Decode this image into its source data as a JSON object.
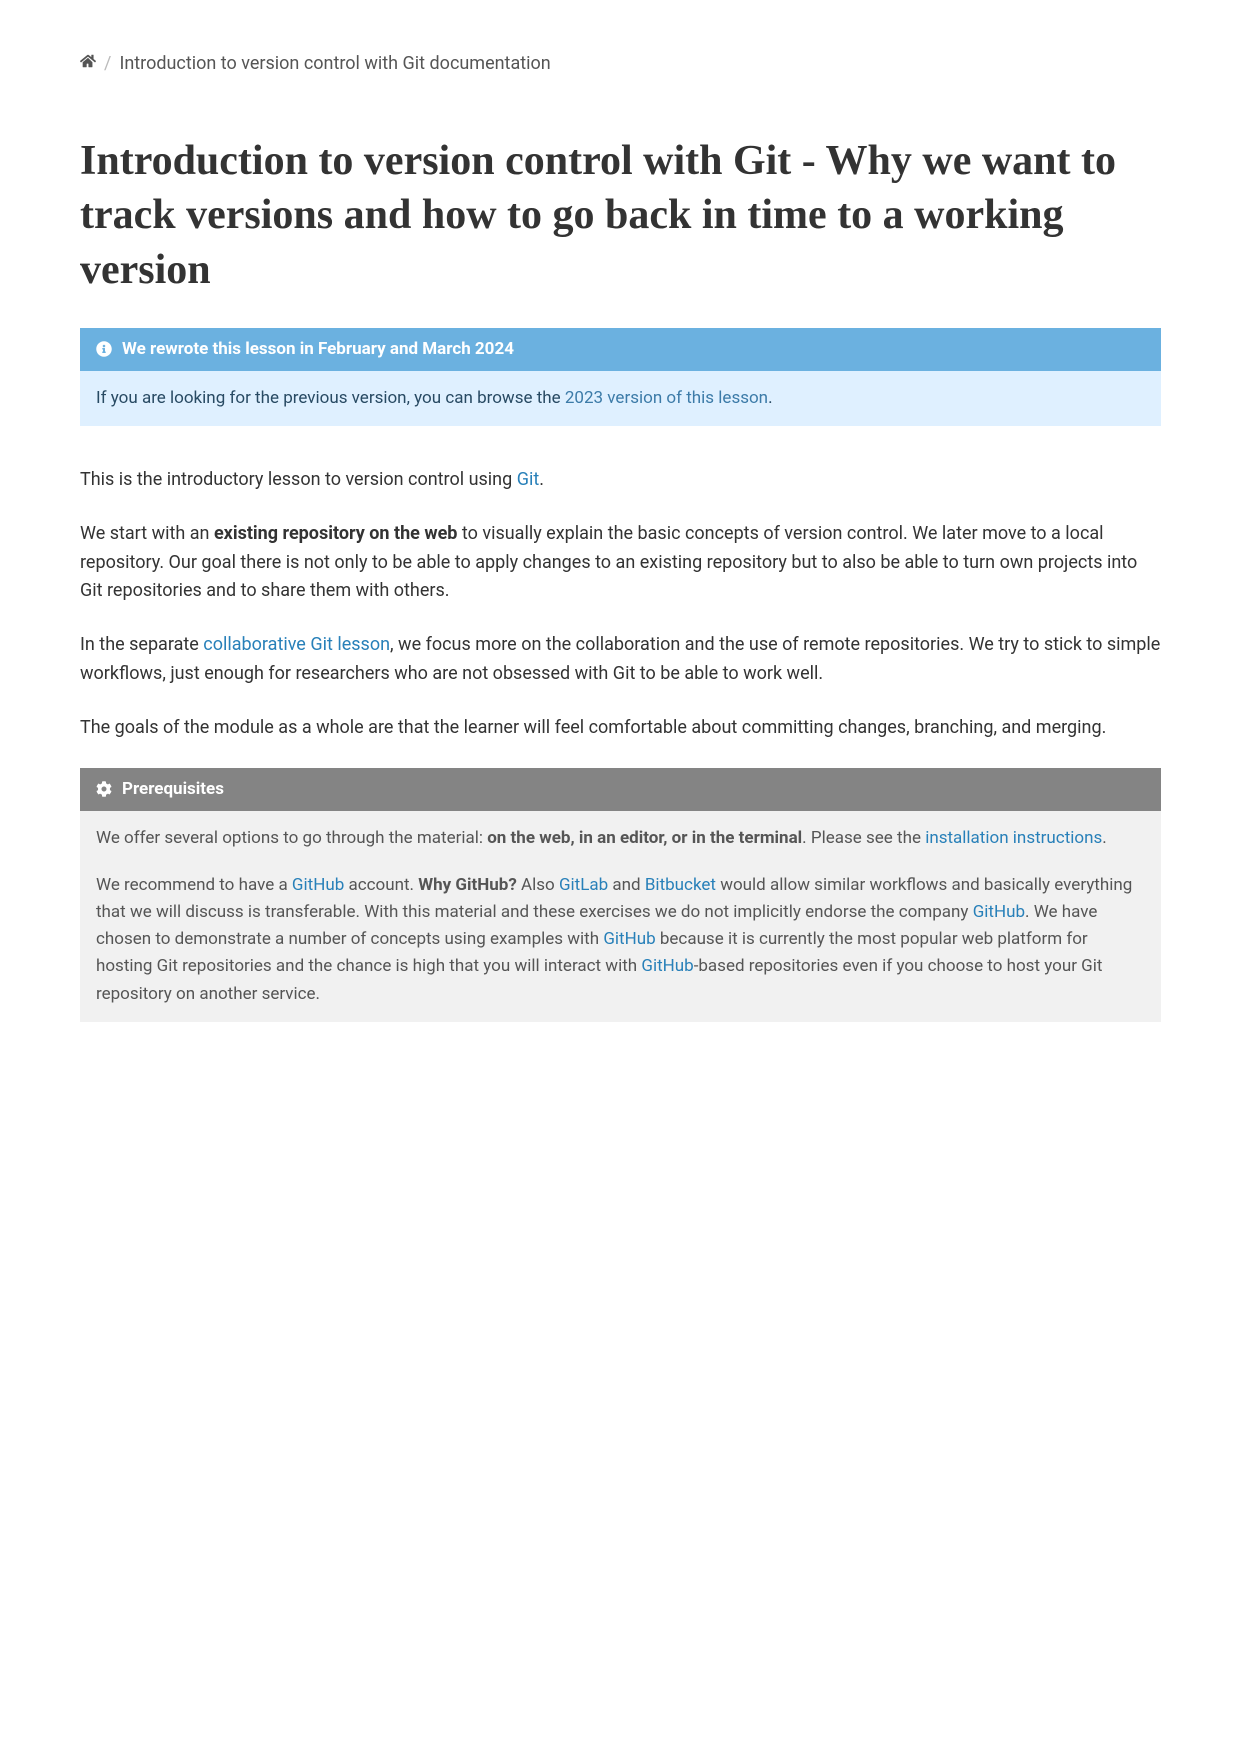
{
  "breadcrumb": {
    "current": "Introduction to version control with Git documentation"
  },
  "title": "Introduction to version control with Git - Why we want to track versions and how to go back in time to a working version",
  "note": {
    "title": "We rewrote this lesson in February and March 2024",
    "body_pre": "If you are looking for the previous version, you can browse the ",
    "body_link": "2023 version of this lesson",
    "body_post": "."
  },
  "intro": {
    "p1_pre": "This is the introductory lesson to version control using ",
    "p1_link": "Git",
    "p1_post": ".",
    "p2_pre": "We start with an ",
    "p2_bold": "existing repository on the web",
    "p2_post": " to visually explain the basic concepts of version control. We later move to a local repository. Our goal there is not only to be able to apply changes to an existing repository but to also be able to turn own projects into Git repositories and to share them with others.",
    "p3_pre": "In the separate ",
    "p3_link": "collaborative Git lesson",
    "p3_post": ", we focus more on the collaboration and the use of remote repositories. We try to stick to simple workflows, just enough for researchers who are not obsessed with Git to be able to work well.",
    "p4": "The goals of the module as a whole are that the learner will feel comfortable about committing changes, branching, and merging."
  },
  "prereq": {
    "title": "Prerequisites",
    "p1_pre": "We offer several options to go through the material: ",
    "p1_bold": "on the web, in an editor, or in the terminal",
    "p1_mid": ". Please see the ",
    "p1_link": "installation instructions",
    "p1_post": ".",
    "p2_pre": "We recommend to have a ",
    "p2_link1": "GitHub",
    "p2_a": " account. ",
    "p2_bold": "Why GitHub?",
    "p2_b": " Also ",
    "p2_link2": "GitLab",
    "p2_c": " and ",
    "p2_link3": "Bitbucket",
    "p2_d": " would allow similar workflows and basically everything that we will discuss is transferable. With this material and these exercises we do not implicitly endorse the company ",
    "p2_link4": "GitHub",
    "p2_e": ". We have chosen to demonstrate a number of concepts using examples with ",
    "p2_link5": "GitHub",
    "p2_f": " because it is currently the most popular web platform for hosting Git repositories and the chance is high that you will interact with ",
    "p2_link6": "GitHub",
    "p2_g": "-based repositories even if you choose to host your Git repository on another service."
  }
}
